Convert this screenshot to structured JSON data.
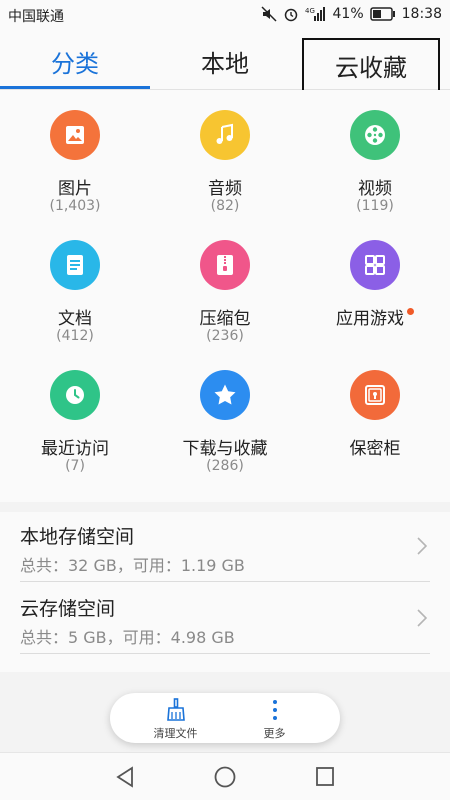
{
  "status_bar": {
    "carrier": "中国联通",
    "battery": "41%",
    "time": "18:38",
    "icons": [
      "mute-icon",
      "alarm-icon",
      "signal-4g-icon",
      "battery-icon"
    ]
  },
  "tabs": [
    {
      "label": "分类",
      "active": true
    },
    {
      "label": "本地",
      "active": false
    },
    {
      "label": "云收藏",
      "active": false
    }
  ],
  "categories": [
    {
      "label": "图片",
      "count": "(1,403)",
      "icon": "image-icon",
      "color": "#f4733b"
    },
    {
      "label": "音频",
      "count": "(82)",
      "icon": "music-icon",
      "color": "#f7c531"
    },
    {
      "label": "视频",
      "count": "(119)",
      "icon": "video-reel-icon",
      "color": "#3fc27a"
    },
    {
      "label": "文档",
      "count": "(412)",
      "icon": "document-icon",
      "color": "#29b7e8"
    },
    {
      "label": "压缩包",
      "count": "(236)",
      "icon": "zip-icon",
      "color": "#f0568a"
    },
    {
      "label": "应用游戏",
      "count": "",
      "icon": "apps-icon",
      "color": "#8b5fe6"
    },
    {
      "label": "最近访问",
      "count": "(7)",
      "icon": "clock-icon",
      "color": "#2fc488"
    },
    {
      "label": "下载与收藏",
      "count": "(286)",
      "icon": "star-icon",
      "color": "#2c8df0"
    },
    {
      "label": "保密柜",
      "count": "",
      "icon": "safe-icon",
      "color": "#f26a3a"
    }
  ],
  "storage": [
    {
      "title": "本地存储空间",
      "subtitle": "总共：32 GB，可用：1.19 GB"
    },
    {
      "title": "云存储空间",
      "subtitle": "总共：5 GB，可用：4.98 GB"
    }
  ],
  "bottom_actions": {
    "clean_label": "清理文件",
    "more_label": "更多"
  }
}
